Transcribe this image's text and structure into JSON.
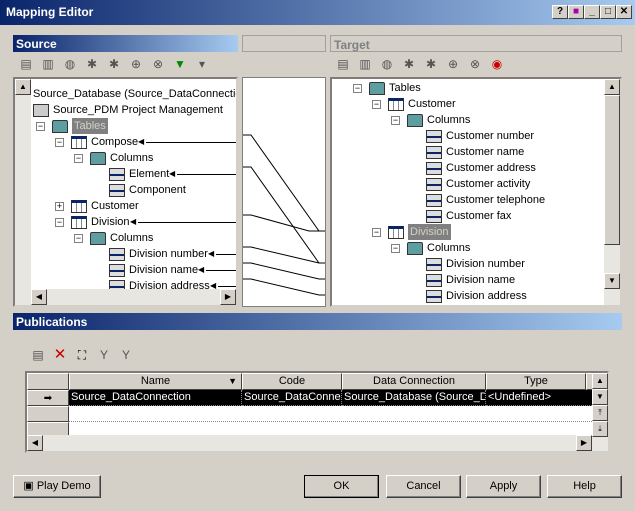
{
  "window": {
    "title": "Mapping Editor",
    "buttons": [
      "?",
      "■",
      "_",
      "□",
      "✕"
    ]
  },
  "source": {
    "header": "Source",
    "tree": [
      {
        "label": "Source_Database (Source_DataConnection)",
        "level": 0,
        "icon": "db"
      },
      {
        "label": "Source_PDM Project Management",
        "level": 0,
        "icon": "db",
        "indent": 1
      },
      {
        "label": "Tables",
        "level": 1,
        "icon": "folder",
        "exp": "−",
        "selected": true
      },
      {
        "label": "Compose",
        "level": 2,
        "icon": "table",
        "exp": "−",
        "arrow": true
      },
      {
        "label": "Columns",
        "level": 3,
        "icon": "folder",
        "exp": "−"
      },
      {
        "label": "Element",
        "level": 4,
        "icon": "column",
        "arrow": true
      },
      {
        "label": "Component",
        "level": 4,
        "icon": "column"
      },
      {
        "label": "Customer",
        "level": 2,
        "icon": "table",
        "exp": "+"
      },
      {
        "label": "Division",
        "level": 2,
        "icon": "table",
        "exp": "−",
        "arrow": true
      },
      {
        "label": "Columns",
        "level": 3,
        "icon": "folder",
        "exp": "−"
      },
      {
        "label": "Division number",
        "level": 4,
        "icon": "column",
        "arrow": true
      },
      {
        "label": "Division name",
        "level": 4,
        "icon": "column",
        "arrow": true
      },
      {
        "label": "Division address",
        "level": 4,
        "icon": "column",
        "arrow": true
      }
    ]
  },
  "target": {
    "header": "Target",
    "tree": [
      {
        "label": "Tables",
        "level": 1,
        "icon": "folder",
        "exp": "−"
      },
      {
        "label": "Customer",
        "level": 2,
        "icon": "table",
        "exp": "−"
      },
      {
        "label": "Columns",
        "level": 3,
        "icon": "folder",
        "exp": "−"
      },
      {
        "label": "Customer number",
        "level": 4,
        "icon": "column"
      },
      {
        "label": "Customer name",
        "level": 4,
        "icon": "column"
      },
      {
        "label": "Customer address",
        "level": 4,
        "icon": "column"
      },
      {
        "label": "Customer activity",
        "level": 4,
        "icon": "column"
      },
      {
        "label": "Customer telephone",
        "level": 4,
        "icon": "column"
      },
      {
        "label": "Customer fax",
        "level": 4,
        "icon": "column"
      },
      {
        "label": "Division",
        "level": 2,
        "icon": "table",
        "exp": "−",
        "selected": true
      },
      {
        "label": "Columns",
        "level": 3,
        "icon": "folder",
        "exp": "−"
      },
      {
        "label": "Division number",
        "level": 4,
        "icon": "column"
      },
      {
        "label": "Division name",
        "level": 4,
        "icon": "column"
      },
      {
        "label": "Division address",
        "level": 4,
        "icon": "column"
      }
    ]
  },
  "publications": {
    "header": "Publications",
    "columns": [
      "Name",
      "Code",
      "Data Connection",
      "Type"
    ],
    "rows": [
      [
        "Source_DataConnection",
        "Source_DataConne",
        "Source_Database (Source_D",
        "<Undefined>"
      ]
    ]
  },
  "buttons": {
    "play_demo": "Play Demo",
    "ok": "OK",
    "cancel": "Cancel",
    "apply": "Apply",
    "help": "Help"
  }
}
